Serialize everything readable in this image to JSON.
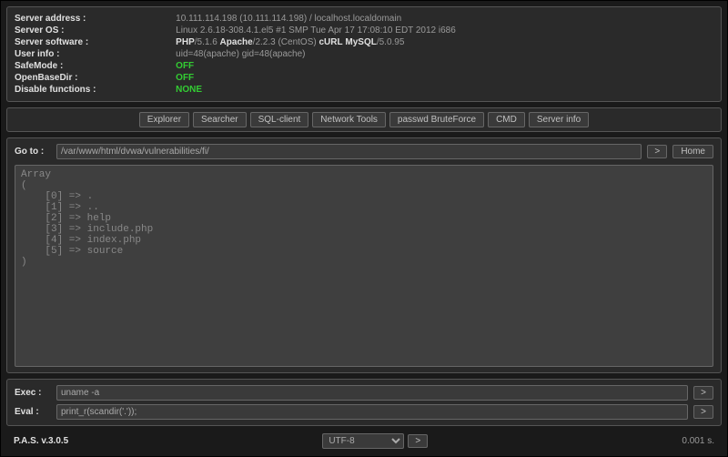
{
  "info": {
    "server_address": {
      "label": "Server address :",
      "value": "10.111.114.198 (10.111.114.198) / localhost.localdomain"
    },
    "server_os": {
      "label": "Server OS :",
      "value": "Linux 2.6.18-308.4.1.el5 #1 SMP Tue Apr 17 17:08:10 EDT 2012 i686"
    },
    "server_software": {
      "label": "Server software :",
      "parts": [
        "PHP",
        "/5.1.6 ",
        "Apache",
        "/2.2.3 (CentOS) ",
        "cURL",
        " ",
        "MySQL",
        "/5.0.95"
      ]
    },
    "user_info": {
      "label": "User info :",
      "value": "uid=48(apache) gid=48(apache)"
    },
    "safemode": {
      "label": "SafeMode :",
      "value": "OFF"
    },
    "openbasedir": {
      "label": "OpenBaseDir :",
      "value": "OFF"
    },
    "disable_functions": {
      "label": "Disable functions :",
      "value": "NONE"
    }
  },
  "nav": [
    "Explorer",
    "Searcher",
    "SQL-client",
    "Network Tools",
    "passwd BruteForce",
    "CMD",
    "Server info"
  ],
  "goto": {
    "label": "Go to :",
    "value": "/var/www/html/dvwa/vulnerabilities/fi/",
    "go": ">",
    "home": "Home"
  },
  "output": "Array\n(\n    [0] => .\n    [1] => ..\n    [2] => help\n    [3] => include.php\n    [4] => index.php\n    [5] => source\n)\n",
  "exec": {
    "label": "Exec :",
    "value": "uname -a",
    "go": ">"
  },
  "eval": {
    "label": "Eval :",
    "value": "print_r(scandir('.'));",
    "go": ">"
  },
  "footer": {
    "version": "P.A.S. v.3.0.5",
    "encoding": "UTF-8",
    "go": ">",
    "time": "0.001 s."
  }
}
